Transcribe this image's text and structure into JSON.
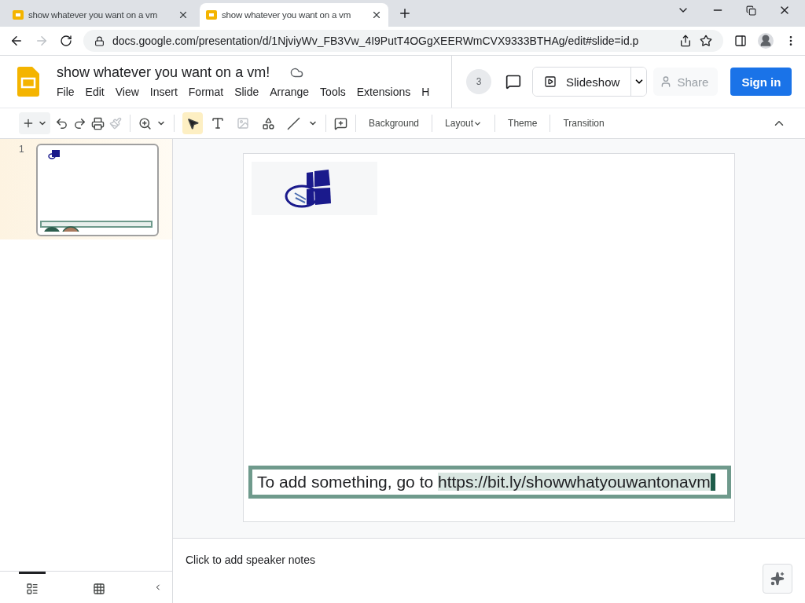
{
  "browser": {
    "tabs": [
      {
        "title": "show whatever you want on a vm",
        "selected": false
      },
      {
        "title": "show whatever you want on a vm",
        "selected": true
      }
    ],
    "address": "docs.google.com/presentation/d/1NjviyWv_FB3Vw_4I9PutT4OGgXEERWmCVX9333BTHAg/edit#slide=id.p"
  },
  "doc": {
    "title": "show whatever you want on a vm!",
    "menus": [
      "File",
      "Edit",
      "View",
      "Insert",
      "Format",
      "Slide",
      "Arrange",
      "Tools",
      "Extensions",
      "H"
    ]
  },
  "header": {
    "viewer_count": "3",
    "slideshow": "Slideshow",
    "share": "Share",
    "sign_in": "Sign in"
  },
  "toolbar": {
    "tools": [
      {
        "kind": "select",
        "selected": true
      },
      {
        "kind": "textbox",
        "selected": false
      },
      {
        "kind": "image",
        "selected": false
      },
      {
        "kind": "shape",
        "selected": false
      },
      {
        "kind": "line",
        "selected": false
      }
    ],
    "buttons": [
      {
        "label": "Background",
        "kind": "plain"
      },
      {
        "label": "Layout",
        "kind": "menu"
      },
      {
        "label": "Theme",
        "kind": "plain"
      },
      {
        "label": "Transition",
        "kind": "plain"
      }
    ]
  },
  "filmstrip": {
    "slides": [
      {
        "number": "1",
        "selected": true
      }
    ],
    "views": [
      {
        "kind": "list",
        "selected": true
      },
      {
        "kind": "grid",
        "selected": false
      }
    ]
  },
  "slide": {
    "textbox": {
      "text": "To add something, go to ",
      "link": "https://bit.ly/showwhatyouwantonavm",
      "selected": true
    }
  },
  "notes": {
    "placeholder": "Click to add speaker notes"
  }
}
